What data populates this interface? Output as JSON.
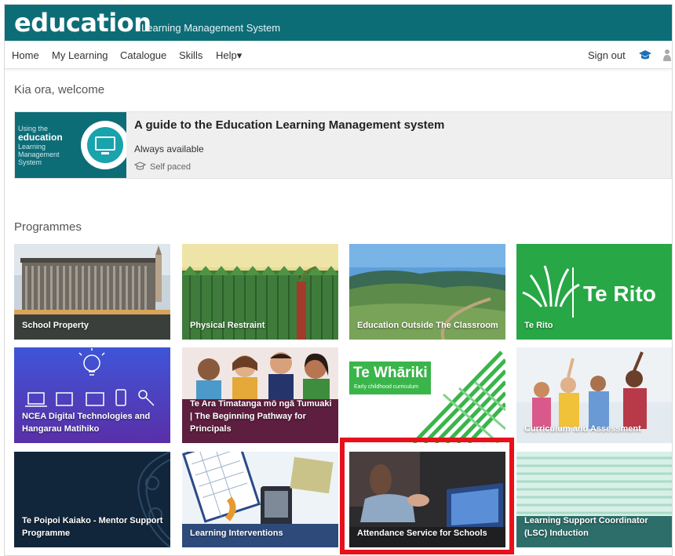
{
  "header": {
    "logo": "education",
    "subtitle": "Learning Management System"
  },
  "nav": {
    "items": [
      "Home",
      "My Learning",
      "Catalogue",
      "Skills",
      "Help▾"
    ],
    "sign_out": "Sign out"
  },
  "welcome": "Kia ora, welcome",
  "featured_course": {
    "thumb_line1": "Using the",
    "thumb_brand": "education",
    "thumb_line2": "Learning",
    "thumb_line3": "Management",
    "thumb_line4": "System",
    "title": "A guide to the Education Learning Management system",
    "availability": "Always available",
    "pace": "Self paced"
  },
  "programmes": {
    "heading": "Programmes",
    "tiles": [
      {
        "label": "School Property"
      },
      {
        "label": "Physical Restraint"
      },
      {
        "label": "Education Outside The Classroom"
      },
      {
        "label": "Te Rito",
        "logo_text": "Te Rito"
      },
      {
        "label": "NCEA Digital Technologies and Hangarau Matihiko"
      },
      {
        "label": "Te Ara Timatanga mō ngā Tumuaki | The Beginning Pathway for Principals"
      },
      {
        "label": "",
        "logo_text": "Te Whāriki",
        "logo_sub": "Early childhood curriculum"
      },
      {
        "label": "Curriculum and Assessment"
      },
      {
        "label": "Te Poipoi Kaiako - Mentor Support Programme"
      },
      {
        "label": "Learning Interventions"
      },
      {
        "label": "Attendance Service for Schools"
      },
      {
        "label": "Learning Support Coordinator (LSC) Induction"
      }
    ]
  },
  "colors": {
    "brand_teal": "#0d6d77",
    "highlight_red": "#e8101a",
    "te_rito_green": "#27a745"
  }
}
